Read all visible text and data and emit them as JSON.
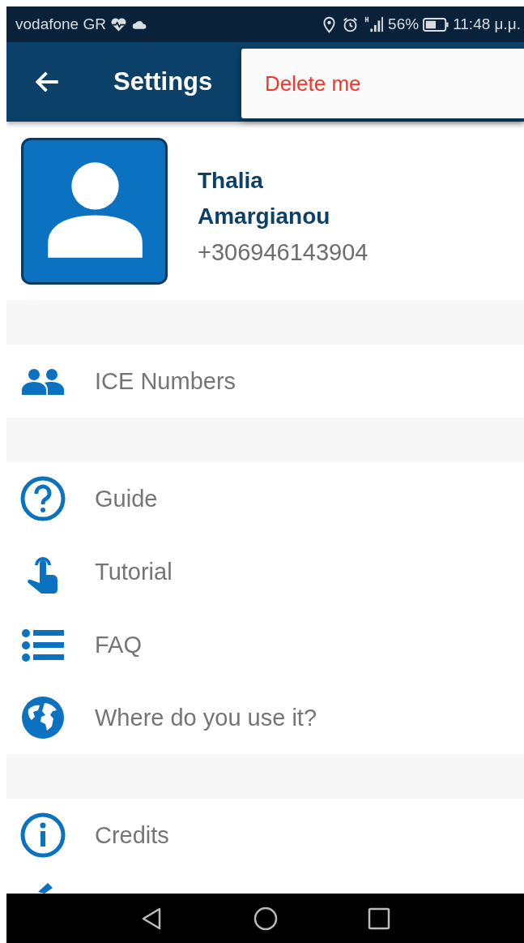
{
  "status_bar": {
    "carrier": "vodafone GR",
    "battery": "56%",
    "time": "11:48 μ.μ."
  },
  "app_bar": {
    "title": "Settings"
  },
  "menu": {
    "items": [
      "Delete me"
    ]
  },
  "profile": {
    "first_name": "Thalia",
    "last_name": "Amargianou",
    "phone": "+306946143904"
  },
  "sections": [
    {
      "items": [
        {
          "label": "ICE Numbers"
        }
      ]
    },
    {
      "items": [
        {
          "label": "Guide"
        },
        {
          "label": "Tutorial"
        },
        {
          "label": "FAQ"
        },
        {
          "label": "Where do you use it?"
        }
      ]
    },
    {
      "items": [
        {
          "label": "Credits"
        }
      ]
    }
  ]
}
